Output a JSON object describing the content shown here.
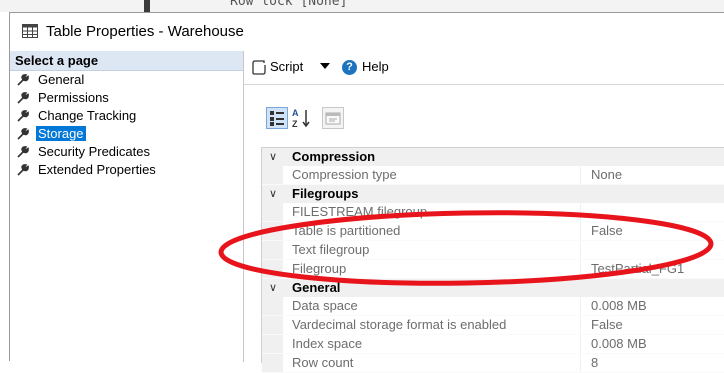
{
  "window": {
    "title": "Table Properties - Warehouse",
    "background_text": "Row lock [None]"
  },
  "left_pane": {
    "header": "Select a page",
    "pages": [
      {
        "label": "General",
        "selected": false
      },
      {
        "label": "Permissions",
        "selected": false
      },
      {
        "label": "Change Tracking",
        "selected": false
      },
      {
        "label": "Storage",
        "selected": true
      },
      {
        "label": "Security Predicates",
        "selected": false
      },
      {
        "label": "Extended Properties",
        "selected": false
      }
    ]
  },
  "toolbar": {
    "script_label": "Script",
    "help_label": "Help",
    "script_icon": "script-icon",
    "help_icon": "help-circle-icon"
  },
  "property_grid": {
    "categories": [
      {
        "name": "Compression",
        "properties": [
          {
            "name": "Compression type",
            "value": "None"
          }
        ]
      },
      {
        "name": "Filegroups",
        "properties": [
          {
            "name": "FILESTREAM filegroup",
            "value": ""
          },
          {
            "name": "Table is partitioned",
            "value": "False"
          },
          {
            "name": "Text filegroup",
            "value": ""
          },
          {
            "name": "Filegroup",
            "value": "TestPartial_FG1"
          }
        ]
      },
      {
        "name": "General",
        "properties": [
          {
            "name": "Data space",
            "value": "0.008 MB"
          },
          {
            "name": "Vardecimal storage format is enabled",
            "value": "False"
          },
          {
            "name": "Index space",
            "value": "0.008 MB"
          },
          {
            "name": "Row count",
            "value": "8"
          }
        ]
      }
    ]
  },
  "colors": {
    "selection": "#0078d7",
    "header_bg": "#dde6f3",
    "annotation_red": "#e8141c"
  }
}
